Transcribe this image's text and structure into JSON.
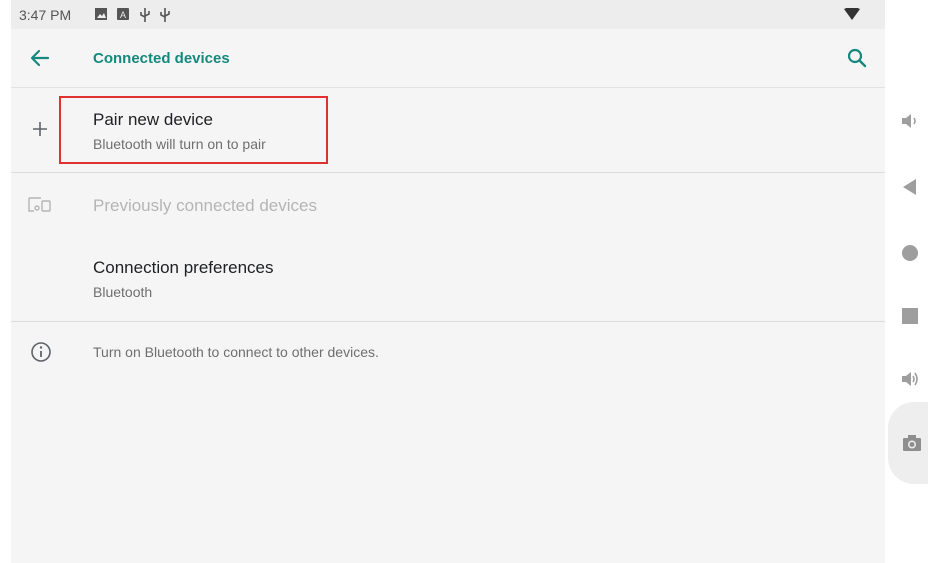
{
  "statusbar": {
    "time": "3:47 PM",
    "icons": [
      "image-icon",
      "notification-icon",
      "usb-icon",
      "usb-icon"
    ],
    "wifi": "wifi-icon"
  },
  "appbar": {
    "title": "Connected devices",
    "back_icon": "back-arrow-icon",
    "search_icon": "search-icon"
  },
  "items": {
    "pair": {
      "title": "Pair new device",
      "subtitle": "Bluetooth will turn on to pair",
      "icon": "plus-icon"
    },
    "previous": {
      "title": "Previously connected devices",
      "icon": "devices-icon"
    },
    "prefs": {
      "title": "Connection preferences",
      "subtitle": "Bluetooth"
    },
    "info": {
      "text": "Turn on Bluetooth to connect to other devices.",
      "icon": "info-icon"
    }
  },
  "colors": {
    "accent": "#16897e",
    "highlight": "#e03131",
    "background": "#f5f5f5"
  },
  "navbar": [
    "volume-down-icon",
    "back-triangle-icon",
    "home-circle-icon",
    "recents-square-icon",
    "volume-up-icon",
    "camera-icon"
  ]
}
